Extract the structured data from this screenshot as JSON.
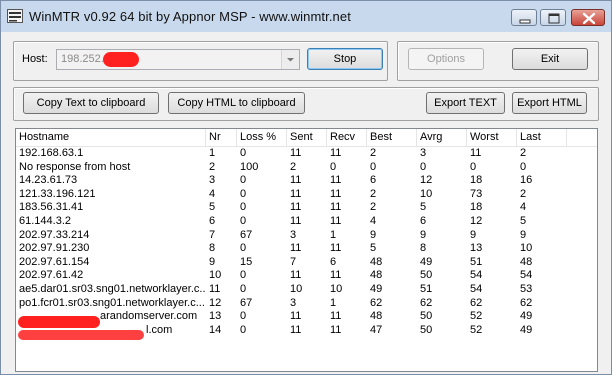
{
  "window": {
    "title": "WinMTR v0.92 64 bit by Appnor MSP - www.winmtr.net"
  },
  "host": {
    "label": "Host:",
    "value": "198.252.",
    "stop_label": "Stop",
    "options_label": "Options",
    "exit_label": "Exit"
  },
  "toolbar": {
    "copy_text_label": "Copy Text to clipboard",
    "copy_html_label": "Copy HTML to clipboard",
    "export_text_label": "Export TEXT",
    "export_html_label": "Export HTML"
  },
  "table": {
    "columns": [
      "Hostname",
      "Nr",
      "Loss %",
      "Sent",
      "Recv",
      "Best",
      "Avrg",
      "Worst",
      "Last"
    ],
    "rows": [
      [
        "192.168.63.1",
        "1",
        "0",
        "11",
        "11",
        "2",
        "3",
        "11",
        "2"
      ],
      [
        "No response from host",
        "2",
        "100",
        "2",
        "0",
        "0",
        "0",
        "0",
        "0"
      ],
      [
        "14.23.61.73",
        "3",
        "0",
        "11",
        "11",
        "6",
        "12",
        "18",
        "16"
      ],
      [
        "121.33.196.121",
        "4",
        "0",
        "11",
        "11",
        "2",
        "10",
        "73",
        "2"
      ],
      [
        "183.56.31.41",
        "5",
        "0",
        "11",
        "11",
        "2",
        "5",
        "18",
        "4"
      ],
      [
        "61.144.3.2",
        "6",
        "0",
        "11",
        "11",
        "4",
        "6",
        "12",
        "5"
      ],
      [
        "202.97.33.214",
        "7",
        "67",
        "3",
        "1",
        "9",
        "9",
        "9",
        "9"
      ],
      [
        "202.97.91.230",
        "8",
        "0",
        "11",
        "11",
        "5",
        "8",
        "13",
        "10"
      ],
      [
        "202.97.61.154",
        "9",
        "15",
        "7",
        "6",
        "48",
        "49",
        "51",
        "48"
      ],
      [
        "202.97.61.42",
        "10",
        "0",
        "11",
        "11",
        "48",
        "50",
        "54",
        "54"
      ],
      [
        "ae5.dar01.sr03.sng01.networklayer.c...",
        "11",
        "0",
        "10",
        "10",
        "49",
        "51",
        "54",
        "53"
      ],
      [
        "po1.fcr01.sr03.sng01.networklayer.c...",
        "12",
        "67",
        "3",
        "1",
        "62",
        "62",
        "62",
        "62"
      ],
      [
        "arandomserver.com",
        "13",
        "0",
        "11",
        "11",
        "48",
        "50",
        "52",
        "49"
      ],
      [
        "l.com",
        "14",
        "0",
        "11",
        "11",
        "47",
        "50",
        "52",
        "49"
      ]
    ]
  },
  "icons": {
    "app": "winmtr-app-icon",
    "minimize": "minimize-icon",
    "maximize": "maximize-icon",
    "close": "close-icon",
    "dropdown": "chevron-down-icon"
  },
  "colors": {
    "titlebar": "#c9d9ed",
    "close_button": "#c9453a",
    "redaction": "#ff2020"
  }
}
